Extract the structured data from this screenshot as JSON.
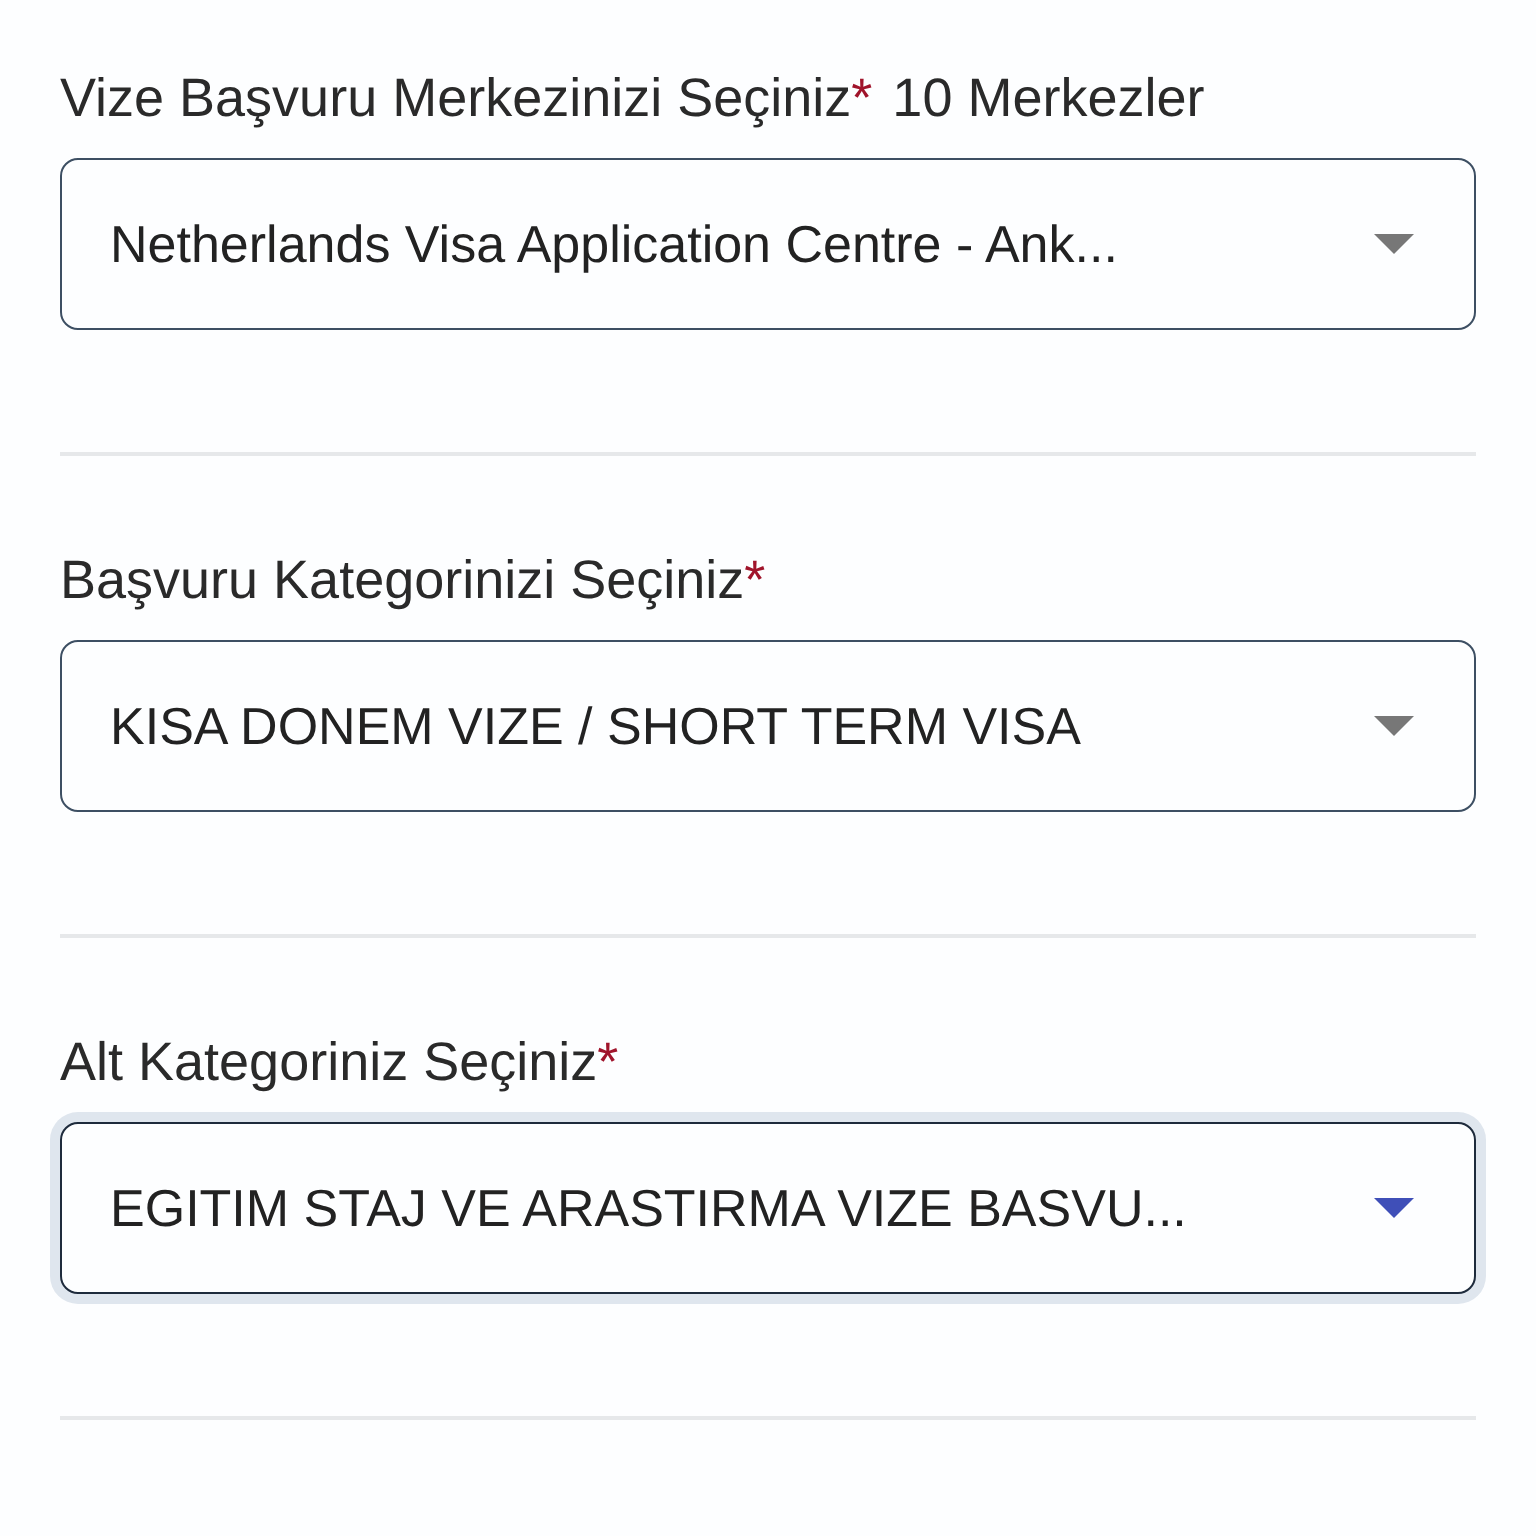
{
  "fields": [
    {
      "label": "Vize Başvuru Merkezinizi Seçiniz",
      "required_mark": "*",
      "count": "10 Merkezler",
      "value": "Netherlands Visa Application Centre - Ank...",
      "focused": false
    },
    {
      "label": "Başvuru Kategorinizi Seçiniz",
      "required_mark": "*",
      "value": "KISA DONEM VIZE / SHORT TERM VISA",
      "focused": false
    },
    {
      "label": "Alt Kategoriniz Seçiniz",
      "required_mark": "*",
      "value": "EGITIM STAJ VE ARASTIRMA VIZE BASVU...",
      "focused": true
    }
  ]
}
